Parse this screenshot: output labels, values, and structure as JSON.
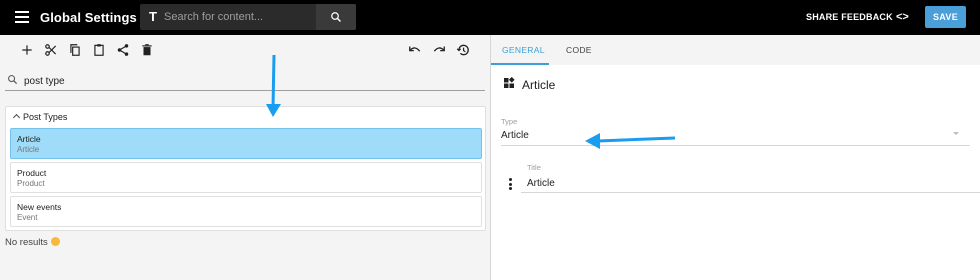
{
  "header": {
    "title": "Global Settings",
    "search_placeholder": "Search for content...",
    "share_feedback_label": "SHARE FEEDBACK",
    "code_toggle_label": "<>",
    "save_label": "SAVE"
  },
  "toolbar": {
    "icons": [
      "add-icon",
      "cut-icon",
      "copy-icon",
      "paste-icon",
      "share-icon",
      "delete-icon",
      "undo-icon",
      "redo-icon",
      "history-icon"
    ]
  },
  "filter": {
    "value": "post type"
  },
  "tree": {
    "group_label": "Post Types",
    "items": [
      {
        "title": "Article",
        "subtitle": "Article",
        "selected": true
      },
      {
        "title": "Product",
        "subtitle": "Product",
        "selected": false
      },
      {
        "title": "New events",
        "subtitle": "Event",
        "selected": false
      }
    ],
    "no_results": "No results"
  },
  "tabs": [
    {
      "label": "GENERAL",
      "active": true
    },
    {
      "label": "CODE",
      "active": false
    }
  ],
  "editor": {
    "heading": "Article",
    "type_field": {
      "label": "Type",
      "value": "Article"
    },
    "title_field": {
      "label": "Title",
      "value": "Article"
    }
  },
  "colors": {
    "accent": "#3aa0d8",
    "save_button": "#4a9fd8",
    "selected_row": "#9fdcf9",
    "annotation_arrow": "#1a9cf0"
  }
}
